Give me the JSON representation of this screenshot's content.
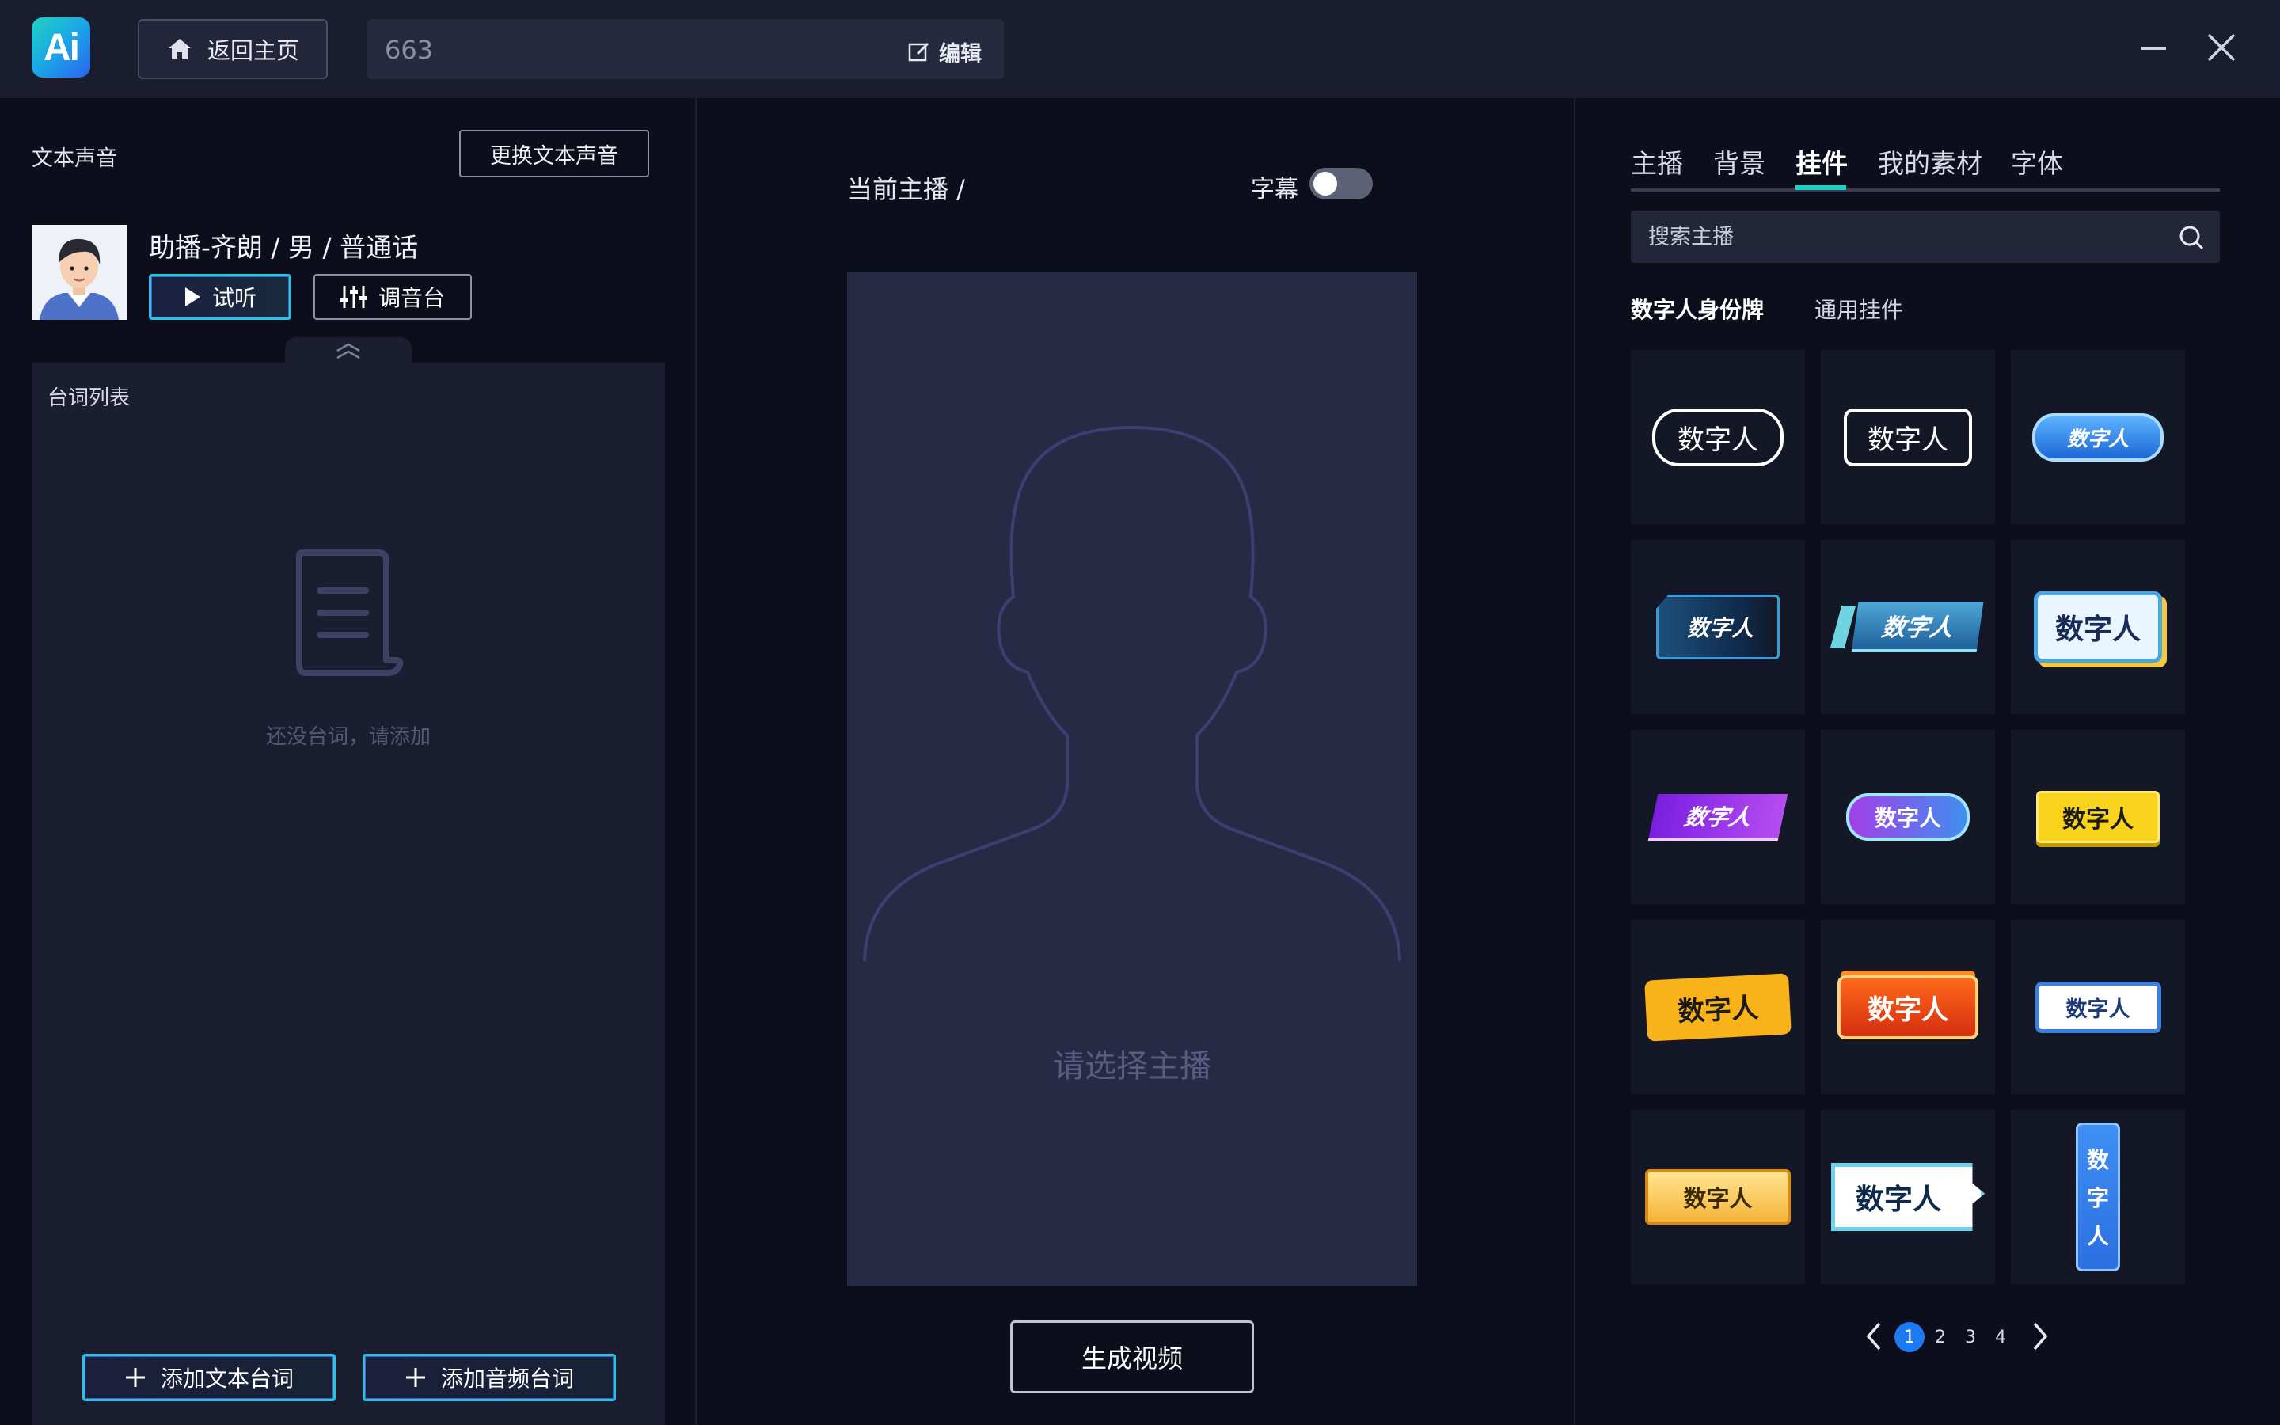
{
  "app": {
    "logo_text": "Ai"
  },
  "titlebar": {
    "home_label": "返回主页",
    "project_name": "663",
    "edit_label": "编辑"
  },
  "left": {
    "voice_section_title": "文本声音",
    "change_voice_label": "更换文本声音",
    "voice_name": "助播-齐朗 / 男 / 普通话",
    "listen_label": "试听",
    "mixer_label": "调音台",
    "lines_title": "台词列表",
    "empty_text": "还没台词，请添加",
    "add_text_label": "添加文本台词",
    "add_audio_label": "添加音频台词"
  },
  "center": {
    "current_host_label": "当前主播 /",
    "subtitle_label": "字幕",
    "subtitle_on": false,
    "preview_placeholder": "请选择主播",
    "generate_label": "生成视频"
  },
  "right": {
    "tabs": [
      {
        "label": "主播",
        "active": false
      },
      {
        "label": "背景",
        "active": false
      },
      {
        "label": "挂件",
        "active": true
      },
      {
        "label": "我的素材",
        "active": false
      },
      {
        "label": "字体",
        "active": false
      }
    ],
    "search_placeholder": "搜索主播",
    "subtabs": [
      {
        "label": "数字人身份牌",
        "active": true
      },
      {
        "label": "通用挂件",
        "active": false
      }
    ],
    "badge_text": "数字人",
    "badge_vertical": [
      "数",
      "字",
      "人"
    ],
    "pagination": {
      "pages": [
        "1",
        "2",
        "3",
        "4"
      ],
      "current": "1"
    }
  },
  "colors": {
    "accent_teal": "#1ed2c8",
    "accent_purple": "#5b4fe2",
    "page_active": "#1d7af3",
    "bg": "#0c0e1b"
  }
}
